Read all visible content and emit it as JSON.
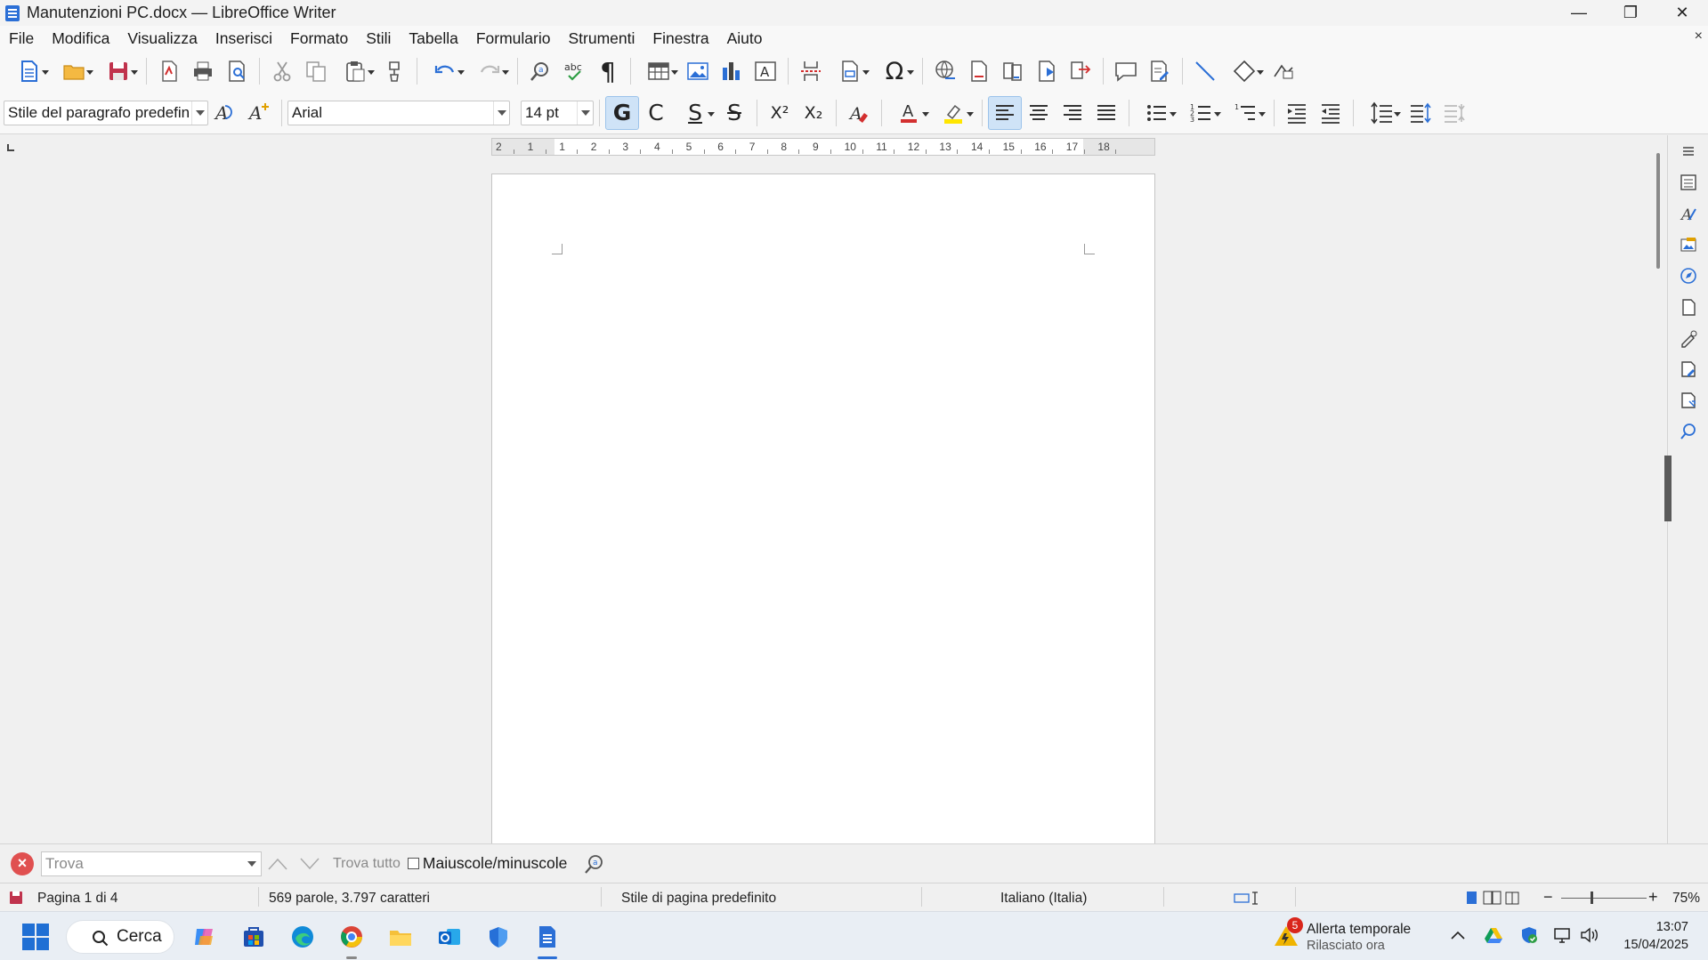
{
  "window": {
    "title": "Manutenzioni PC.docx — LibreOffice Writer",
    "minimize": "—",
    "maximize": "❐",
    "close": "✕"
  },
  "menu": {
    "items": [
      "File",
      "Modifica",
      "Visualizza",
      "Inserisci",
      "Formato",
      "Stili",
      "Tabella",
      "Formulario",
      "Strumenti",
      "Finestra",
      "Aiuto"
    ],
    "close_doc": "×"
  },
  "formatting": {
    "paragraph_style": "Stile del paragrafo predefin",
    "font_name": "Arial",
    "font_size": "14 pt",
    "bold_label": "G",
    "italic_label": "C",
    "underline_label": "S",
    "strike_label": "S",
    "superscript_label": "X²",
    "subscript_label": "X₂",
    "font_color_label": "A",
    "highlight_color": "#ffe600",
    "font_color": "#d32f2f"
  },
  "ruler": {
    "labels": [
      "2",
      "1",
      "1",
      "2",
      "3",
      "4",
      "5",
      "6",
      "7",
      "8",
      "9",
      "10",
      "11",
      "12",
      "13",
      "14",
      "15",
      "16",
      "17",
      "18"
    ]
  },
  "findbar": {
    "placeholder": "Trova",
    "find_all": "Trova tutto",
    "match_case": "Maiuscole/minuscole"
  },
  "status": {
    "page": "Pagina 1 di 4",
    "words": "569 parole, 3.797 caratteri",
    "page_style": "Stile di pagina predefinito",
    "language": "Italiano (Italia)",
    "zoom": "75%",
    "zoom_percent": 75
  },
  "taskbar": {
    "search_label": "Cerca",
    "weather_title": "Allerta temporale",
    "weather_sub": "Rilasciato ora",
    "weather_badge": "5",
    "time": "13:07",
    "date": "15/04/2025"
  },
  "colors": {
    "accent": "#2b6fd6",
    "active_button": "#cfe3f7"
  }
}
